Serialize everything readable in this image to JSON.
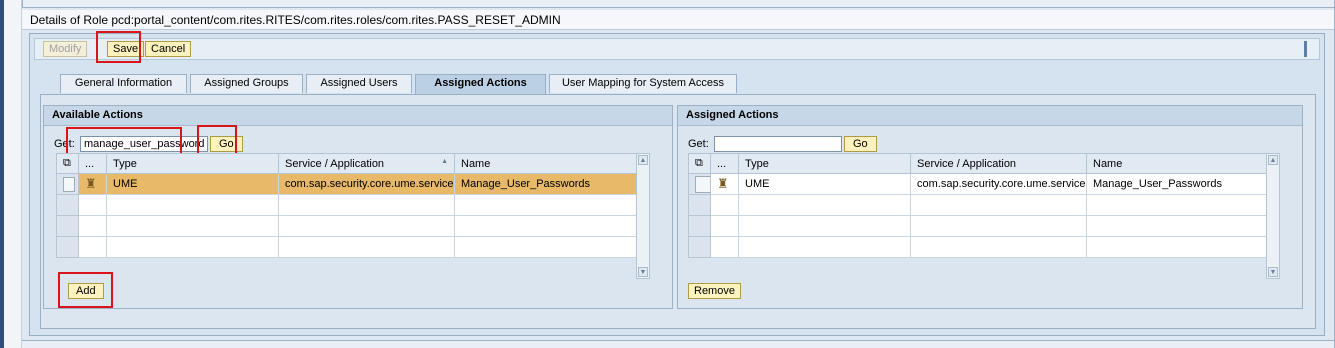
{
  "page": {
    "title": "Details of Role pcd:portal_content/com.rites.RITES/com.rites.roles/com.rites.PASS_RESET_ADMIN"
  },
  "toolbar": {
    "modify_label": "Modify",
    "save_label": "Save",
    "cancel_label": "Cancel"
  },
  "tabs": [
    {
      "label": "General Information",
      "active": false
    },
    {
      "label": "Assigned Groups",
      "active": false
    },
    {
      "label": "Assigned Users",
      "active": false
    },
    {
      "label": "Assigned Actions",
      "active": true
    },
    {
      "label": "User Mapping for System Access",
      "active": false
    }
  ],
  "available_actions": {
    "title": "Available Actions",
    "get_label": "Get:",
    "search_value": "manage_user_password",
    "go_label": "Go",
    "columns": [
      "...",
      "Type",
      "Service / Application",
      "Name"
    ],
    "sort_indicator": "▲",
    "rows": [
      {
        "icon": "person-icon",
        "type": "UME",
        "service": "com.sap.security.core.ume.service",
        "name": "Manage_User_Passwords",
        "highlighted": true
      }
    ],
    "add_label": "Add"
  },
  "assigned_actions": {
    "title": "Assigned Actions",
    "get_label": "Get:",
    "search_value": "",
    "go_label": "Go",
    "columns": [
      "...",
      "Type",
      "Service / Application",
      "Name"
    ],
    "rows": [
      {
        "icon": "person-icon",
        "type": "UME",
        "service": "com.sap.security.core.ume.service",
        "name": "Manage_User_Passwords",
        "highlighted": false
      }
    ],
    "remove_label": "Remove"
  },
  "colors": {
    "highlight_row": "#e7b969",
    "button_bg": "#fcf2bd",
    "annotation_red": "#d9141c",
    "panel_bg": "#dae5f0"
  }
}
